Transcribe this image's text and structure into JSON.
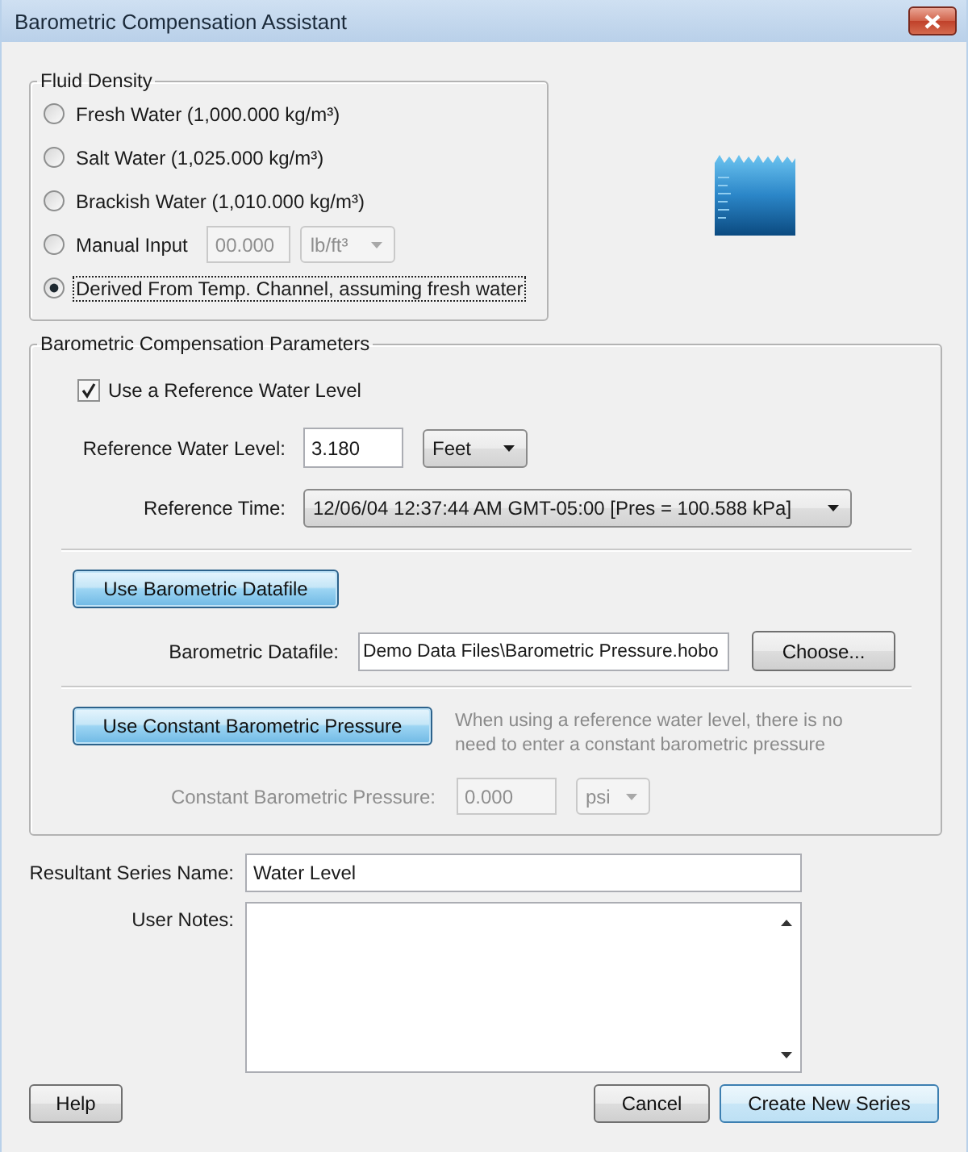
{
  "window": {
    "title": "Barometric Compensation Assistant"
  },
  "fluid_density": {
    "legend": "Fluid Density",
    "options": [
      {
        "kind": "preset",
        "label": "Fresh Water (1,000.000 kg/m³)",
        "selected": false,
        "focused": false
      },
      {
        "kind": "preset",
        "label": "Salt Water (1,025.000 kg/m³)",
        "selected": false,
        "focused": false
      },
      {
        "kind": "preset",
        "label": "Brackish Water (1,010.000 kg/m³)",
        "selected": false,
        "focused": false
      },
      {
        "kind": "manual",
        "label": "Manual Input",
        "selected": false,
        "focused": false,
        "value": "00.000",
        "unit": "lb/ft³",
        "disabled": true
      },
      {
        "kind": "preset",
        "label": "Derived From Temp. Channel, assuming fresh water",
        "selected": true,
        "focused": true
      }
    ]
  },
  "parameters": {
    "legend": "Barometric Compensation Parameters",
    "reference_checkbox": {
      "label": "Use a Reference Water Level",
      "checked": true
    },
    "reference_level": {
      "label": "Reference Water Level:",
      "value": "3.180",
      "unit": "Feet"
    },
    "reference_time": {
      "label": "Reference Time:",
      "value": "12/06/04 12:37:44 AM GMT-05:00 [Pres = 100.588 kPa]"
    },
    "datafile_button": {
      "label": "Use Barometric Datafile",
      "kind": "accent"
    },
    "datafile": {
      "label": "Barometric Datafile:",
      "value": "Demo Data Files\\Barometric Pressure.hobo",
      "button": "Choose..."
    },
    "constant_button": {
      "label": "Use Constant Barometric Pressure",
      "kind": "accent"
    },
    "constant_hint": "When using a reference water level, there is no need to enter a constant barometric pressure",
    "constant_pressure": {
      "label": "Constant Barometric Pressure:",
      "value": "0.000",
      "unit": "psi",
      "disabled": true
    }
  },
  "series_name": {
    "label": "Resultant Series Name:",
    "value": "Water Level"
  },
  "user_notes": {
    "label": "User Notes:"
  },
  "footer": {
    "left_buttons": [
      {
        "label": "Help",
        "kind": "normal"
      }
    ],
    "right_buttons": [
      {
        "label": "Cancel",
        "kind": "normal"
      },
      {
        "label": "Create New Series",
        "kind": "default"
      }
    ]
  }
}
